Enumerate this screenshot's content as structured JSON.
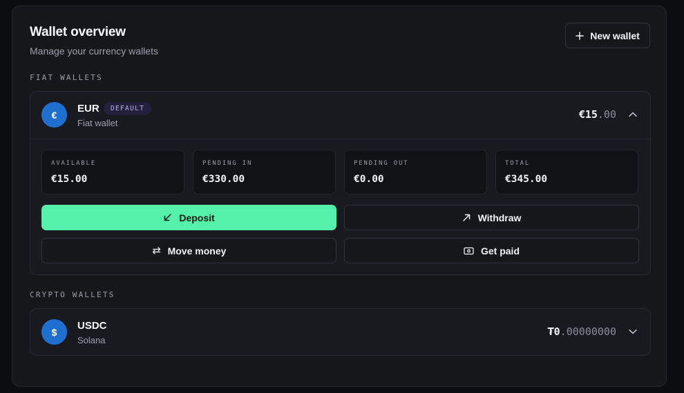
{
  "header": {
    "title": "Wallet overview",
    "subtitle": "Manage your currency wallets",
    "new_wallet_label": "New wallet"
  },
  "fiat": {
    "section_label": "FIAT WALLETS",
    "wallet": {
      "symbol": "€",
      "name": "EUR",
      "badge": "DEFAULT",
      "type": "Fiat wallet",
      "balance_main": "€15",
      "balance_decimals": ".00",
      "expanded": true,
      "stats": [
        {
          "label": "AVAILABLE",
          "value": "€15.00"
        },
        {
          "label": "PENDING IN",
          "value": "€330.00"
        },
        {
          "label": "PENDING OUT",
          "value": "€0.00"
        },
        {
          "label": "TOTAL",
          "value": "€345.00"
        }
      ],
      "actions": {
        "deposit": "Deposit",
        "withdraw": "Withdraw",
        "move_money": "Move money",
        "get_paid": "Get paid"
      }
    }
  },
  "crypto": {
    "section_label": "CRYPTO WALLETS",
    "wallet": {
      "symbol": "$",
      "name": "USDC",
      "network": "Solana",
      "balance_main": "₮0",
      "balance_decimals": ".00000000",
      "expanded": false
    }
  },
  "colors": {
    "accent": "#55f0aa",
    "coin": "#1f6fd1",
    "badge_bg": "#231f3d",
    "panel": "#15171b"
  },
  "icons": [
    "plus-icon",
    "euro-icon",
    "chevron-up-icon",
    "arrow-down-left-icon",
    "arrow-up-right-icon",
    "arrows-exchange-icon",
    "banknote-icon",
    "dollar-icon",
    "chevron-down-icon"
  ]
}
